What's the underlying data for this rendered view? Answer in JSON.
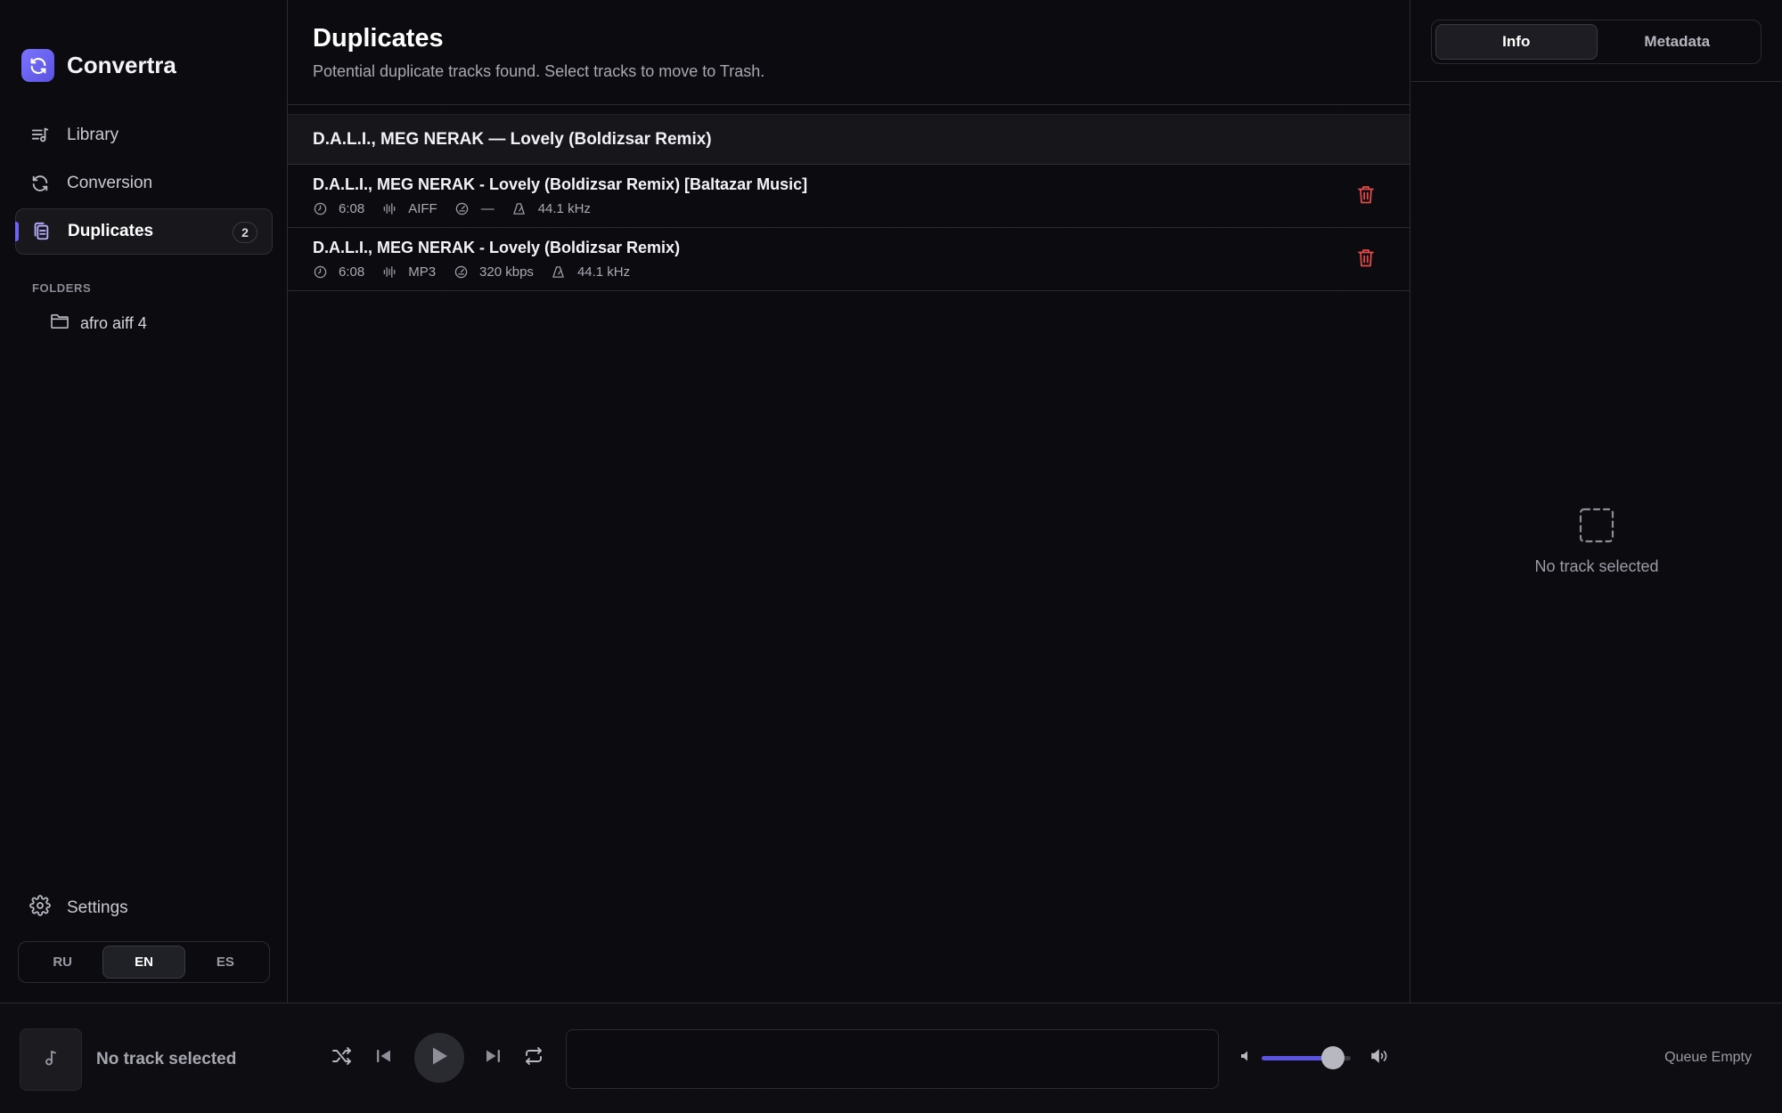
{
  "app": {
    "name": "Convertra",
    "accent": "#6c63ff"
  },
  "sidebar": {
    "items": [
      {
        "label": "Library",
        "icon": "library-music-icon"
      },
      {
        "label": "Conversion",
        "icon": "refresh-icon"
      },
      {
        "label": "Duplicates",
        "icon": "copy-files-icon",
        "badge": "2",
        "active": true
      }
    ],
    "folders_title": "FOLDERS",
    "folders": [
      {
        "label": "afro aiff 4",
        "icon": "folder-icon"
      }
    ],
    "settings_label": "Settings",
    "languages": [
      "RU",
      "EN",
      "ES"
    ],
    "active_language": "EN"
  },
  "main": {
    "title": "Duplicates",
    "subtitle": "Potential duplicate tracks found. Select tracks to move to Trash.",
    "group_title": "D.A.L.I., MEG  NERAK — Lovely (Boldizsar Remix)",
    "tracks": [
      {
        "title": "D.A.L.I., MEG  NERAK - Lovely (Boldizsar Remix) [Baltazar Music]",
        "duration": "6:08",
        "format": "AIFF",
        "bitrate": "—",
        "sample_rate": "44.1 kHz"
      },
      {
        "title": "D.A.L.I., MEG  NERAK - Lovely (Boldizsar Remix)",
        "duration": "6:08",
        "format": "MP3",
        "bitrate": "320 kbps",
        "sample_rate": "44.1 kHz"
      }
    ]
  },
  "right_panel": {
    "tabs": [
      "Info",
      "Metadata"
    ],
    "active_tab": "Info",
    "empty_text": "No track selected"
  },
  "player": {
    "now_playing": "No track selected",
    "volume": 0.8,
    "queue_label": "Queue Empty"
  }
}
